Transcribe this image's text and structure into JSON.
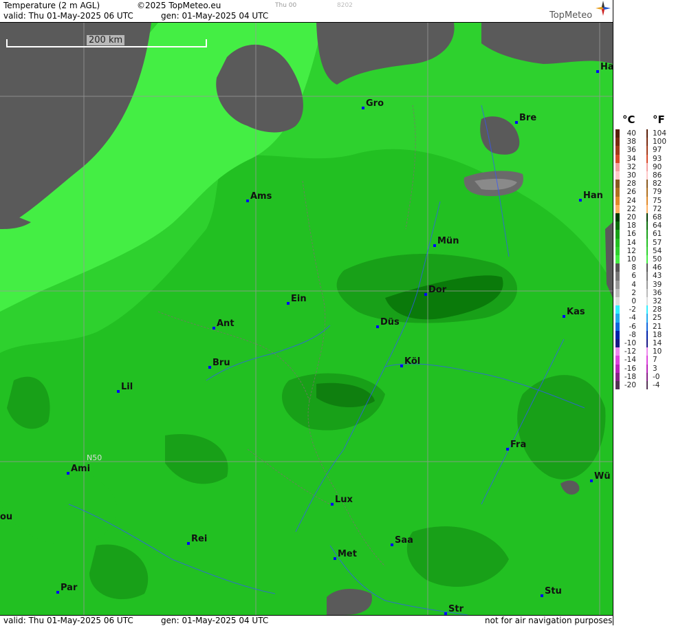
{
  "header": {
    "title": "Temperature (2 m AGL)",
    "copyright": "©2025 TopMeteo.eu",
    "day": "Thu 00",
    "code": "8202",
    "valid": "valid:  Thu  01-May-2025  06 UTC",
    "gen": "gen: 01-May-2025 04 UTC",
    "logo": "TopMeteo"
  },
  "footer": {
    "valid": "valid:  Thu  01-May-2025  06 UTC",
    "gen": "gen: 01-May-2025 04 UTC",
    "note": "not for air navigation purposes"
  },
  "map": {
    "scale_label": "200 km",
    "grid_label": "N50",
    "cities": [
      {
        "name": "Ha",
        "id": "ha"
      },
      {
        "name": "Gro",
        "id": "gro"
      },
      {
        "name": "Bre",
        "id": "bre"
      },
      {
        "name": "Ams",
        "id": "ams"
      },
      {
        "name": "Han",
        "id": "han"
      },
      {
        "name": "Mün",
        "id": "mun"
      },
      {
        "name": "Dor",
        "id": "dor"
      },
      {
        "name": "Ein",
        "id": "ein"
      },
      {
        "name": "Kas",
        "id": "kas"
      },
      {
        "name": "Düs",
        "id": "dus"
      },
      {
        "name": "Ant",
        "id": "ant"
      },
      {
        "name": "Köl",
        "id": "kol"
      },
      {
        "name": "Bru",
        "id": "bru"
      },
      {
        "name": "Lil",
        "id": "lil"
      },
      {
        "name": "Fra",
        "id": "fra"
      },
      {
        "name": "Ami",
        "id": "ami"
      },
      {
        "name": "Wü",
        "id": "wu"
      },
      {
        "name": "ou",
        "id": "ou"
      },
      {
        "name": "Lux",
        "id": "lux"
      },
      {
        "name": "Rei",
        "id": "rei"
      },
      {
        "name": "Saa",
        "id": "saa"
      },
      {
        "name": "Met",
        "id": "met"
      },
      {
        "name": "Stu",
        "id": "stu"
      },
      {
        "name": "Par",
        "id": "par"
      },
      {
        "name": "Str",
        "id": "str"
      }
    ]
  },
  "legend": {
    "unit_c": "°C",
    "unit_f": "°F",
    "rows": [
      {
        "c": "40",
        "f": "104",
        "color": "#5a1e0a"
      },
      {
        "c": "38",
        "f": "100",
        "color": "#7a2a10"
      },
      {
        "c": "36",
        "f": "97",
        "color": "#a33a1a"
      },
      {
        "c": "34",
        "f": "93",
        "color": "#d84a2a"
      },
      {
        "c": "32",
        "f": "90",
        "color": "#f4a0a0"
      },
      {
        "c": "30",
        "f": "86",
        "color": "#ffc8c8"
      },
      {
        "c": "28",
        "f": "82",
        "color": "#8a5a20"
      },
      {
        "c": "26",
        "f": "79",
        "color": "#b07020"
      },
      {
        "c": "24",
        "f": "75",
        "color": "#e08a2a"
      },
      {
        "c": "22",
        "f": "72",
        "color": "#ffb060"
      },
      {
        "c": "20",
        "f": "68",
        "color": "#003a00"
      },
      {
        "c": "18",
        "f": "64",
        "color": "#0a6e0a"
      },
      {
        "c": "16",
        "f": "61",
        "color": "#18a018"
      },
      {
        "c": "14",
        "f": "57",
        "color": "#22c022"
      },
      {
        "c": "12",
        "f": "54",
        "color": "#2ed12e"
      },
      {
        "c": "10",
        "f": "50",
        "color": "#44ee44"
      },
      {
        "c": "8",
        "f": "46",
        "color": "#555555"
      },
      {
        "c": "6",
        "f": "43",
        "color": "#777777"
      },
      {
        "c": "4",
        "f": "39",
        "color": "#999999"
      },
      {
        "c": "2",
        "f": "36",
        "color": "#bbbbbb"
      },
      {
        "c": "0",
        "f": "32",
        "color": "#dddddd"
      },
      {
        "c": "-2",
        "f": "28",
        "color": "#33eeff"
      },
      {
        "c": "-4",
        "f": "25",
        "color": "#22aaee"
      },
      {
        "c": "-6",
        "f": "21",
        "color": "#1166dd"
      },
      {
        "c": "-8",
        "f": "18",
        "color": "#0022aa"
      },
      {
        "c": "-10",
        "f": "14",
        "color": "#1a1a88"
      },
      {
        "c": "-12",
        "f": "10",
        "color": "#ee88ee"
      },
      {
        "c": "-14",
        "f": "7",
        "color": "#dd44dd"
      },
      {
        "c": "-16",
        "f": "3",
        "color": "#bb22bb"
      },
      {
        "c": "-18",
        "f": "-0",
        "color": "#882288"
      },
      {
        "c": "-20",
        "f": "-4",
        "color": "#553355"
      }
    ]
  }
}
